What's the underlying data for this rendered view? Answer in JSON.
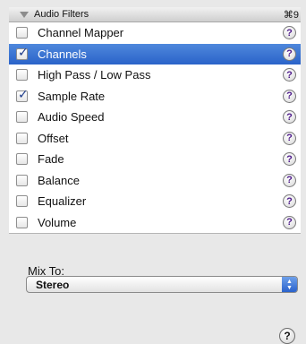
{
  "header": {
    "title": "Audio Filters",
    "shortcut": "⌘9"
  },
  "filters": [
    {
      "label": "Channel Mapper",
      "checked": false
    },
    {
      "label": "Channels",
      "checked": true,
      "selected": true
    },
    {
      "label": "High Pass / Low Pass",
      "checked": false
    },
    {
      "label": "Sample Rate",
      "checked": true
    },
    {
      "label": "Audio Speed",
      "checked": false
    },
    {
      "label": "Offset",
      "checked": false
    },
    {
      "label": "Fade",
      "checked": false
    },
    {
      "label": "Balance",
      "checked": false
    },
    {
      "label": "Equalizer",
      "checked": false
    },
    {
      "label": "Volume",
      "checked": false
    }
  ],
  "help_glyph": "?",
  "check_glyph": "✓",
  "mix": {
    "label": "Mix To:",
    "value": "Stereo"
  },
  "colors": {
    "selection": "#2f6ad0",
    "help_glyph": "#4d1a8a"
  }
}
